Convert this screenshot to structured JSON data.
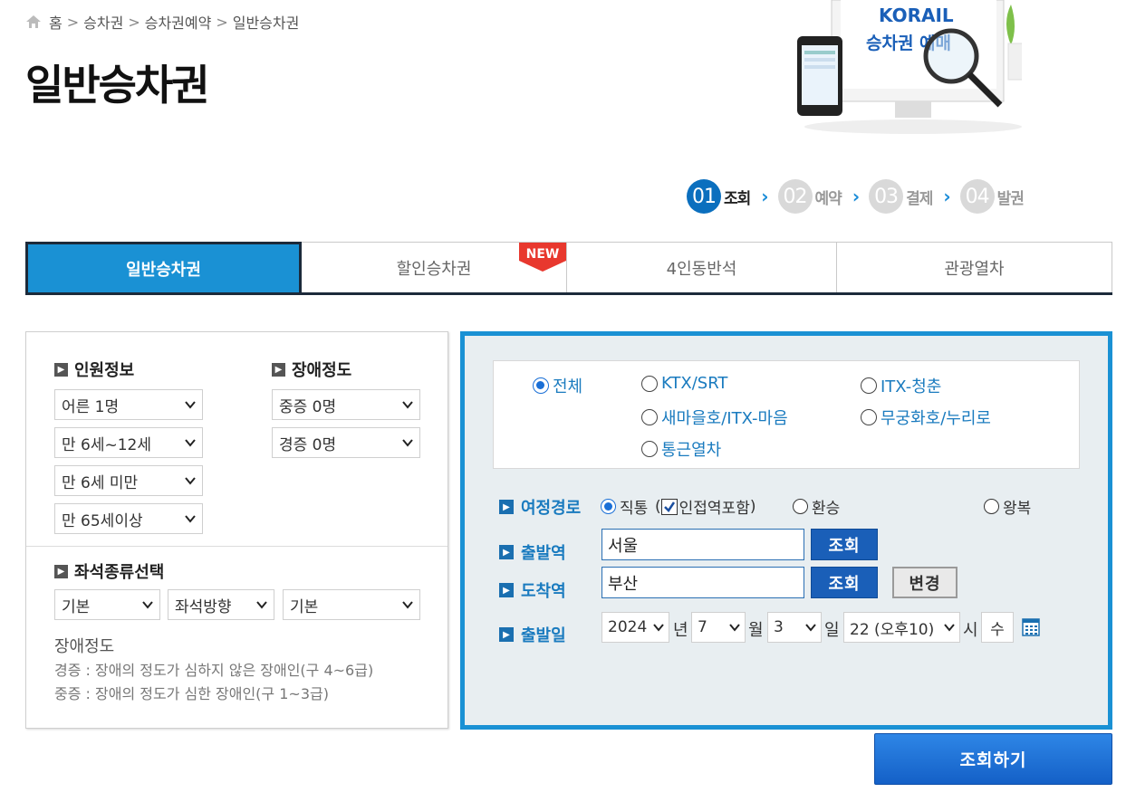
{
  "breadcrumb": {
    "items": [
      "홈",
      "승차권",
      "승차권예약",
      "일반승차권"
    ],
    "separator": ">"
  },
  "page_title": "일반승차권",
  "hero": {
    "brand": "KORAIL",
    "caption": "승차권 예매"
  },
  "steps": [
    {
      "num": "01",
      "label": "조회",
      "active": true
    },
    {
      "num": "02",
      "label": "예약",
      "active": false
    },
    {
      "num": "03",
      "label": "결제",
      "active": false
    },
    {
      "num": "04",
      "label": "발권",
      "active": false
    }
  ],
  "tabs": [
    {
      "label": "일반승차권",
      "active": true
    },
    {
      "label": "할인승차권",
      "badge": "NEW"
    },
    {
      "label": "4인동반석"
    },
    {
      "label": "관광열차"
    }
  ],
  "passengers": {
    "title": "인원정보",
    "selects": [
      "어른 1명",
      "만 6세~12세",
      "만 6세 미만",
      "만 65세이상"
    ]
  },
  "disability": {
    "title": "장애정도",
    "selects": [
      "중증 0명",
      "경증 0명"
    ]
  },
  "seat": {
    "title": "좌석종류선택",
    "selects": [
      "기본",
      "좌석방향",
      "기본"
    ]
  },
  "disability_info": {
    "heading": "장애정도",
    "lines": [
      "경증 : 장애의 정도가 심하지 않은 장애인(구 4~6급)",
      "중증 : 장애의 정도가 심한 장애인(구 1~3급)"
    ]
  },
  "train_types": [
    {
      "label": "전체",
      "selected": true
    },
    {
      "label": "KTX/SRT",
      "selected": false
    },
    {
      "label": "ITX-청춘",
      "selected": false
    },
    {
      "label": "새마을호/ITX-마음",
      "selected": false
    },
    {
      "label": "무궁화호/누리로",
      "selected": false
    },
    {
      "label": "통근열차",
      "selected": false
    }
  ],
  "route": {
    "label": "여정경로",
    "direct": "직통",
    "paren_open": "(",
    "nearby": "인접역포함",
    "paren_close": ")",
    "transfer": "환승",
    "roundtrip": "왕복"
  },
  "departure": {
    "label": "출발역",
    "value": "서울",
    "search_button": "조회"
  },
  "arrival": {
    "label": "도착역",
    "value": "부산",
    "search_button": "조회",
    "swap_button": "변경"
  },
  "date": {
    "label": "출발일",
    "year": "2024",
    "year_unit": "년",
    "month": "7",
    "month_unit": "월",
    "day": "3",
    "day_unit": "일",
    "hour": "22 (오후10)",
    "hour_unit": "시",
    "weekday": "수"
  },
  "submit_label": "조회하기",
  "colors": {
    "accent": "#1a91d4",
    "button": "#1a5fb8",
    "link": "#1a7bbf"
  }
}
